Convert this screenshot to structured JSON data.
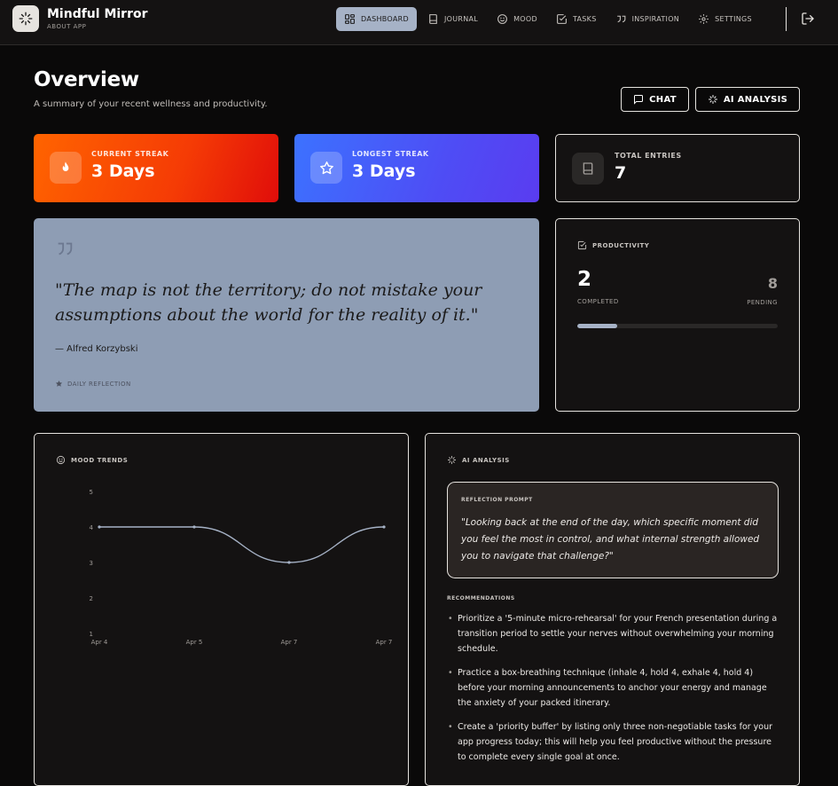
{
  "app": {
    "title": "Mindful Mirror",
    "subtitle": "ABOUT APP"
  },
  "nav": [
    {
      "label": "DASHBOARD",
      "icon": "dashboard-icon",
      "active": true
    },
    {
      "label": "JOURNAL",
      "icon": "book-icon",
      "active": false
    },
    {
      "label": "MOOD",
      "icon": "smile-icon",
      "active": false
    },
    {
      "label": "TASKS",
      "icon": "checkbox-icon",
      "active": false
    },
    {
      "label": "INSPIRATION",
      "icon": "quote-icon",
      "active": false
    },
    {
      "label": "SETTINGS",
      "icon": "gear-icon",
      "active": false
    }
  ],
  "overview": {
    "title": "Overview",
    "subtitle": "A summary of your recent wellness and productivity.",
    "chat_label": "CHAT",
    "ai_label": "AI ANALYSIS"
  },
  "stats": {
    "current_streak": {
      "label": "CURRENT STREAK",
      "value": "3 Days",
      "icon": "flame-icon"
    },
    "longest_streak": {
      "label": "LONGEST STREAK",
      "value": "3 Days",
      "icon": "star-icon"
    },
    "total_entries": {
      "label": "TOTAL ENTRIES",
      "value": "7",
      "icon": "book-icon"
    }
  },
  "quote": {
    "text": "\"The map is not the territory; do not mistake your assumptions about the world for the reality of it.\"",
    "author": "— Alfred Korzybski",
    "footer": "DAILY REFLECTION"
  },
  "productivity": {
    "label": "PRODUCTIVITY",
    "completed": "2",
    "completed_label": "COMPLETED",
    "pending": "8",
    "pending_label": "PENDING",
    "progress_fraction": 0.2
  },
  "mood": {
    "label": "MOOD TRENDS",
    "chart_data": {
      "type": "line",
      "x": [
        "Apr 4",
        "Apr 5",
        "Apr 7",
        "Apr 7"
      ],
      "y_ticks": [
        "1",
        "2",
        "3",
        "4",
        "5"
      ],
      "values": [
        4,
        4,
        3,
        4
      ],
      "ylim": [
        1,
        5
      ],
      "grid": false,
      "line_color": "#a6b2c6"
    }
  },
  "ai": {
    "label": "AI ANALYSIS",
    "prompt_label": "REFLECTION PROMPT",
    "prompt_text": "\"Looking back at the end of the day, which specific moment did you feel the most in control, and what internal strength allowed you to navigate that challenge?\"",
    "recommendations_label": "RECOMMENDATIONS",
    "recommendations": [
      "Prioritize a '5-minute micro-rehearsal' for your French presentation during a transition period to settle your nerves without overwhelming your morning schedule.",
      "Practice a box-breathing technique (inhale 4, hold 4, exhale 4, hold 4) before your morning announcements to anchor your energy and manage the anxiety of your packed itinerary.",
      "Create a 'priority buffer' by listing only three non-negotiable tasks for your app progress today; this will help you feel productive without the pressure to complete every single goal at once."
    ]
  },
  "colors": {
    "accent": "#a6b2c6",
    "streak_orange": "#ff6400",
    "streak_blue": "#3c72ff",
    "quote_bg": "#8e9db4"
  }
}
